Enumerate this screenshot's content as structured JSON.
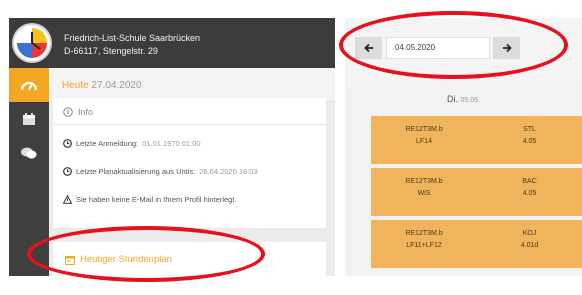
{
  "school": {
    "name": "Friedrich-List-Schule Saarbrücken",
    "address": "D-66117, Stengelstr. 29"
  },
  "sidebar": {
    "items": [
      {
        "icon": "dashboard-icon",
        "active": true
      },
      {
        "icon": "calendar-icon",
        "active": false
      },
      {
        "icon": "chat-icon",
        "active": false
      }
    ]
  },
  "today": {
    "label": "Heute",
    "date": "27.04.2020"
  },
  "info": {
    "title": "Info",
    "last_login_label": "Letzte Anmeldung:",
    "last_login_value": "01.01.1970 01:00",
    "last_update_label": "Letzte Planaktualisierung aus Untis:",
    "last_update_value": "26.04.2020 18:03",
    "profile_text": "Sie haben keine E-Mail in Ihrem Profil hinterlegt."
  },
  "schedule_link": {
    "label": "Heutiger Stundenplan"
  },
  "date_nav": {
    "date_value": "04.05.2020"
  },
  "day": {
    "name": "Di.",
    "date": "05.05."
  },
  "lessons": [
    {
      "class": "RE12T3M.b",
      "subject": "LF14",
      "teacher": "STL",
      "room": "4.05"
    },
    {
      "class": "RE12T3M.b",
      "subject": "WiS",
      "teacher": "BAC",
      "room": "4.05"
    },
    {
      "class": "RE12T3M.b",
      "subject": "LF11+LF12",
      "teacher": "KOJ",
      "room": "4.01d"
    }
  ],
  "colors": {
    "accent": "#f5a623",
    "lesson": "#f0b45c",
    "annotation": "#e8101a",
    "header": "#3c3c3c"
  }
}
